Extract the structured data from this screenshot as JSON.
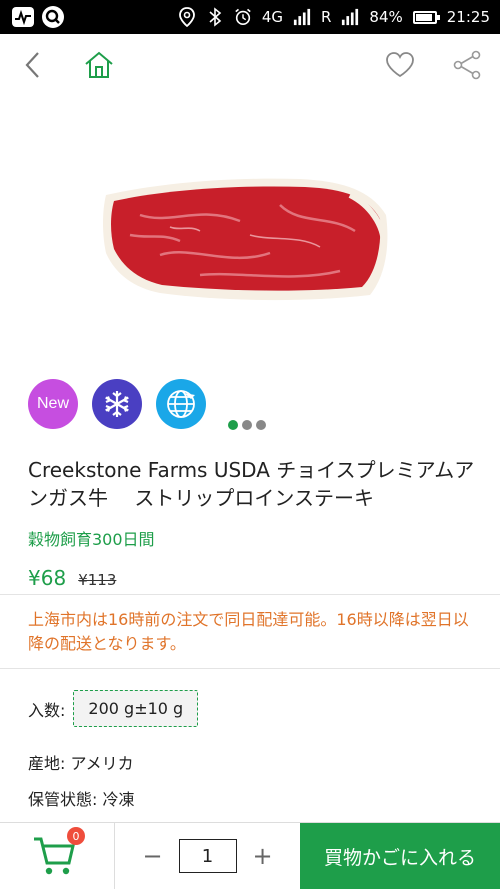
{
  "status_bar": {
    "network": "4G",
    "sim_slot": "R",
    "battery_percent": "84%",
    "time": "21:25"
  },
  "nav": {
    "icons": [
      "back-icon",
      "home-icon",
      "heart-icon",
      "share-icon"
    ],
    "accent_color": "#1e9e4a"
  },
  "product": {
    "image_icon": "steak-image",
    "badges": [
      {
        "label": "New",
        "color": "#c64ee0"
      },
      {
        "icon": "snowflake-icon",
        "color": "#4a3fc2"
      },
      {
        "icon": "globe-icon",
        "color": "#1aa7e8"
      }
    ],
    "carousel": {
      "count": 3,
      "active": 0
    },
    "title": "Creekstone Farms USDA チョイスプレミアムアンガス牛　 ストリップロインステーキ",
    "subtitle": "穀物飼育300日間",
    "price": "¥68",
    "original_price": "¥113",
    "notice": "上海市内は16時前の注文で同日配達可能。16時以降は翌日以降の配送となります。",
    "spec_label": "入数:",
    "spec_value": "200 g±10 g",
    "origin": "産地: アメリカ",
    "storage": "保管状態: 冷凍"
  },
  "bottom_bar": {
    "cart_count": "0",
    "minus_label": "−",
    "quantity": "1",
    "plus_label": "+",
    "add_to_cart_label": "買物かごに入れる",
    "button_color": "#1e9e4a",
    "badge_color": "#ef4d3c"
  }
}
